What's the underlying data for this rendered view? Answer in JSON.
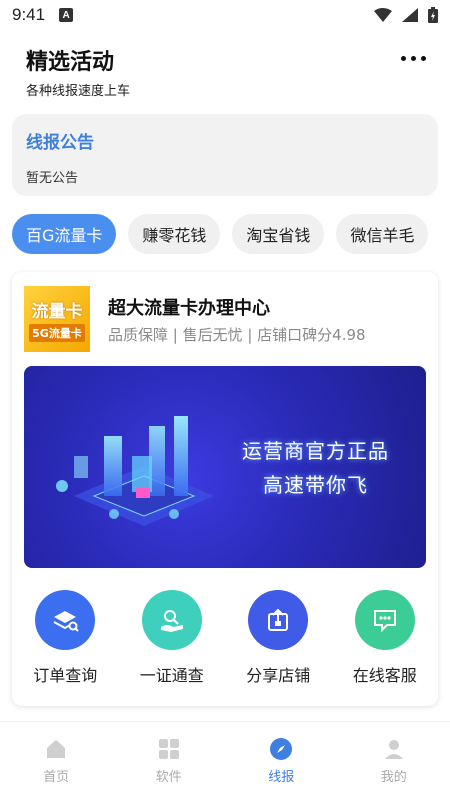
{
  "status": {
    "time": "9:41",
    "notif_letter": "A"
  },
  "header": {
    "title": "精选活动",
    "subtitle": "各种线报速度上车"
  },
  "notice": {
    "title": "线报公告",
    "text": "暂无公告"
  },
  "tabs": [
    {
      "label": "百G流量卡",
      "active": true
    },
    {
      "label": "赚零花钱",
      "active": false
    },
    {
      "label": "淘宝省钱",
      "active": false
    },
    {
      "label": "微信羊毛",
      "active": false
    }
  ],
  "shop": {
    "logo_line1": "流量卡",
    "logo_line2": "5G流量卡",
    "name": "超大流量卡办理中心",
    "meta": "品质保障 | 售后无忧 | 店铺口碑分4.98"
  },
  "banner": {
    "line1": "运营商官方正品",
    "line2": "高速带你飞"
  },
  "actions": [
    {
      "label": "订单查询",
      "color": "#3c6ff0",
      "icon": "layers-search-icon"
    },
    {
      "label": "一证通查",
      "color": "#3fcfbd",
      "icon": "hand-search-icon"
    },
    {
      "label": "分享店铺",
      "color": "#3f5be8",
      "icon": "share-upload-icon"
    },
    {
      "label": "在线客服",
      "color": "#3ccd96",
      "icon": "chat-bubble-icon"
    }
  ],
  "nav": [
    {
      "label": "首页",
      "active": false,
      "icon": "home-icon"
    },
    {
      "label": "软件",
      "active": false,
      "icon": "grid-icon"
    },
    {
      "label": "线报",
      "active": true,
      "icon": "compass-icon"
    },
    {
      "label": "我的",
      "active": false,
      "icon": "user-icon"
    }
  ],
  "colors": {
    "accent": "#3f7fe0",
    "tab_active": "#4a8ef0"
  }
}
